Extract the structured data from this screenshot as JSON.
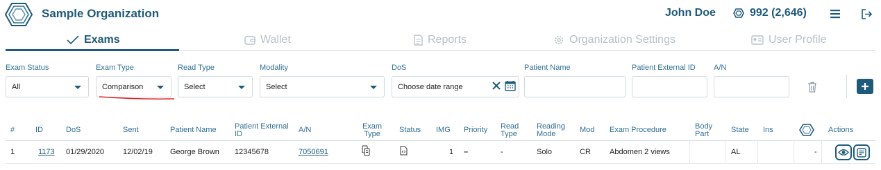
{
  "header": {
    "org_name": "Sample Organization",
    "user_name": "John Doe",
    "credits": "992 (2,646)"
  },
  "tabs": [
    {
      "label": "Exams",
      "icon": "check-icon",
      "active": true
    },
    {
      "label": "Wallet",
      "icon": "wallet-icon",
      "active": false
    },
    {
      "label": "Reports",
      "icon": "document-icon",
      "active": false
    },
    {
      "label": "Organization Settings",
      "icon": "gear-icon",
      "active": false
    },
    {
      "label": "User Profile",
      "icon": "id-card-icon",
      "active": false
    }
  ],
  "filters": {
    "exam_status": {
      "label": "Exam Status",
      "value": "All"
    },
    "exam_type": {
      "label": "Exam Type",
      "value": "Comparison"
    },
    "read_type": {
      "label": "Read Type",
      "value": "Select"
    },
    "modality": {
      "label": "Modality",
      "value": "Select"
    },
    "dos": {
      "label": "DoS",
      "value": "Choose date range"
    },
    "patient_name": {
      "label": "Patient Name",
      "value": ""
    },
    "patient_external_id": {
      "label": "Patient External ID",
      "value": ""
    },
    "an": {
      "label": "A/N",
      "value": ""
    }
  },
  "table": {
    "columns": [
      "#",
      "ID",
      "DoS",
      "Sent",
      "Patient Name",
      "Patient External ID",
      "A/N",
      "Exam Type",
      "Status",
      "IMG",
      "Priority",
      "Read Type",
      "Reading Mode",
      "Mod",
      "Exam Procedure",
      "Body Part",
      "State",
      "Ins",
      "",
      "Actions"
    ],
    "rows": [
      {
        "num": "1",
        "id": "1173",
        "dos": "01/29/2020",
        "sent": "12/02/19",
        "patient_name": "George Brown",
        "patient_external_id": "12345678",
        "an": "7050691",
        "img": "1",
        "priority": "–",
        "read_type": "-",
        "reading_mode": "Solo",
        "mod": "CR",
        "exam_procedure": "Abdomen 2 views",
        "body_part": "",
        "state": "AL",
        "ins": "",
        "logo_col": "-"
      }
    ]
  },
  "colors": {
    "brand": "#1e5a7a",
    "label": "#2f6f93",
    "muted": "#b8c1c8",
    "annotation": "#e02020"
  }
}
